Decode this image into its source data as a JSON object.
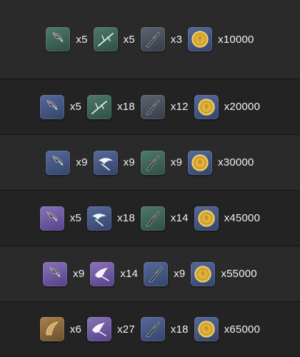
{
  "rows": [
    {
      "items": [
        {
          "icon": "claw-icon",
          "rarity": "green",
          "qty": "x5"
        },
        {
          "icon": "branch-icon",
          "rarity": "green",
          "qty": "x5"
        },
        {
          "icon": "blade-icon",
          "rarity": "slate",
          "qty": "x3"
        },
        {
          "icon": "coin-icon",
          "rarity": "blue",
          "qty": "x10000"
        }
      ]
    },
    {
      "items": [
        {
          "icon": "claw-icon",
          "rarity": "blue",
          "qty": "x5"
        },
        {
          "icon": "branch-icon",
          "rarity": "green",
          "qty": "x18"
        },
        {
          "icon": "blade-icon",
          "rarity": "slate",
          "qty": "x12"
        },
        {
          "icon": "coin-icon",
          "rarity": "blue",
          "qty": "x20000"
        }
      ]
    },
    {
      "items": [
        {
          "icon": "claw-icon",
          "rarity": "blue",
          "qty": "x9"
        },
        {
          "icon": "wing-icon",
          "rarity": "blue",
          "qty": "x9"
        },
        {
          "icon": "blade-icon",
          "rarity": "green",
          "qty": "x9"
        },
        {
          "icon": "coin-icon",
          "rarity": "blue",
          "qty": "x30000"
        }
      ]
    },
    {
      "items": [
        {
          "icon": "claw-icon",
          "rarity": "purple",
          "qty": "x5"
        },
        {
          "icon": "wing-icon",
          "rarity": "blue",
          "qty": "x18"
        },
        {
          "icon": "blade-icon",
          "rarity": "green",
          "qty": "x14"
        },
        {
          "icon": "coin-icon",
          "rarity": "blue",
          "qty": "x45000"
        }
      ]
    },
    {
      "items": [
        {
          "icon": "claw-icon",
          "rarity": "purple",
          "qty": "x9"
        },
        {
          "icon": "bird-icon",
          "rarity": "purple",
          "qty": "x14"
        },
        {
          "icon": "blade-icon",
          "rarity": "blue",
          "qty": "x9"
        },
        {
          "icon": "coin-icon",
          "rarity": "blue",
          "qty": "x55000"
        }
      ]
    },
    {
      "items": [
        {
          "icon": "horn-icon",
          "rarity": "gold",
          "qty": "x6"
        },
        {
          "icon": "bird-icon",
          "rarity": "purple",
          "qty": "x27"
        },
        {
          "icon": "blade-icon",
          "rarity": "blue",
          "qty": "x18"
        },
        {
          "icon": "coin-icon",
          "rarity": "blue",
          "qty": "x65000"
        }
      ]
    }
  ],
  "colors": {
    "coin": "#e2b33a",
    "claw": "#1f1f22",
    "blade": "#2a2d33"
  }
}
